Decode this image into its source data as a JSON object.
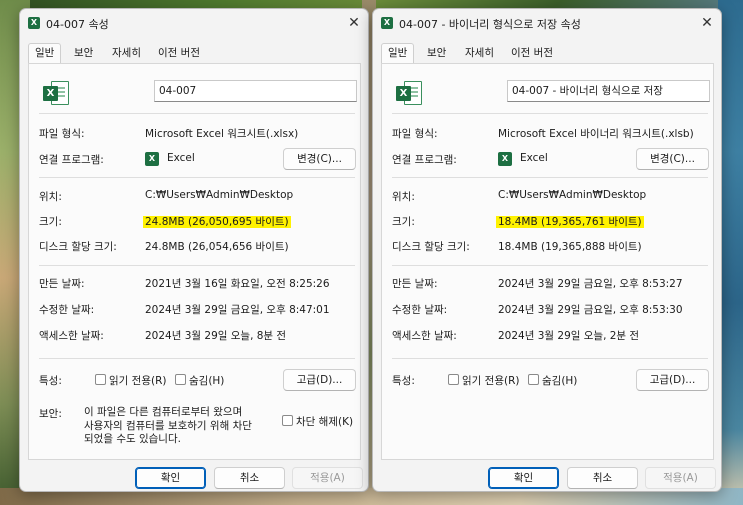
{
  "left": {
    "title": "04-007 속성",
    "tabs": [
      "일반",
      "보안",
      "자세히",
      "이전 버전"
    ],
    "file_name": "04-007",
    "file_type_label": "파일 형식:",
    "file_type_value": "Microsoft Excel 워크시트(.xlsx)",
    "open_with_label": "연결 프로그램:",
    "open_with_app": "Excel",
    "change_button": "변경(C)...",
    "location_label": "위치:",
    "location_value": "C:₩Users₩Admin₩Desktop",
    "size_label": "크기:",
    "size_value": "24.8MB (26,050,695 바이트)",
    "size_on_disk_label": "디스크 할당 크기:",
    "size_on_disk_value": "24.8MB (26,054,656 바이트)",
    "created_label": "만든 날짜:",
    "created_value": "2021년 3월 16일 화요일, 오전 8:25:26",
    "modified_label": "수정한 날짜:",
    "modified_value": "2024년 3월 29일 금요일, 오후 8:47:01",
    "accessed_label": "액세스한 날짜:",
    "accessed_value": "2024년 3월 29일 오늘, 8분 전",
    "attributes_label": "특성:",
    "readonly_label": "읽기 전용(R)",
    "hidden_label": "숨김(H)",
    "advanced_button": "고급(D)...",
    "security_label": "보안:",
    "security_lines": [
      "이 파일은 다른 컴퓨터로부터 왔으며",
      "사용자의 컴퓨터를 보호하기 위해 차단",
      "되었을 수도 있습니다."
    ],
    "unblock_label": "차단 해제(K)",
    "ok_button": "확인",
    "cancel_button": "취소",
    "apply_button": "적용(A)"
  },
  "right": {
    "title": "04-007 - 바이너리 형식으로 저장 속성",
    "tabs": [
      "일반",
      "보안",
      "자세히",
      "이전 버전"
    ],
    "file_name": "04-007 - 바이너리 형식으로 저장",
    "file_type_label": "파일 형식:",
    "file_type_value": "Microsoft Excel 바이너리 워크시트(.xlsb)",
    "open_with_label": "연결 프로그램:",
    "open_with_app": "Excel",
    "change_button": "변경(C)...",
    "location_label": "위치:",
    "location_value": "C:₩Users₩Admin₩Desktop",
    "size_label": "크기:",
    "size_value": "18.4MB (19,365,761 바이트)",
    "size_on_disk_label": "디스크 할당 크기:",
    "size_on_disk_value": "18.4MB (19,365,888 바이트)",
    "created_label": "만든 날짜:",
    "created_value": "2024년 3월 29일 금요일, 오후 8:53:27",
    "modified_label": "수정한 날짜:",
    "modified_value": "2024년 3월 29일 금요일, 오후 8:53:30",
    "accessed_label": "액세스한 날짜:",
    "accessed_value": "2024년 3월 29일 오늘, 2분 전",
    "attributes_label": "특성:",
    "readonly_label": "읽기 전용(R)",
    "hidden_label": "숨김(H)",
    "advanced_button": "고급(D)...",
    "ok_button": "확인",
    "cancel_button": "취소",
    "apply_button": "적용(A)"
  },
  "colors": {
    "highlight": "#fff200",
    "excel_green": "#1d6f42",
    "accent": "#005fb8"
  },
  "icons": {
    "title": "excel-file-icon",
    "close": "close-icon",
    "file": "excel-file-icon",
    "app": "excel-app-icon"
  }
}
